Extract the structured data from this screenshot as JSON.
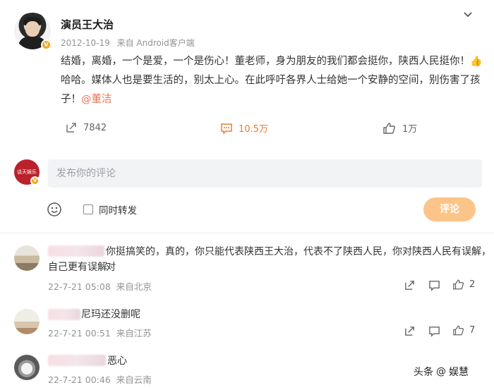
{
  "post": {
    "author": "演员王大治",
    "date": "2012-10-19",
    "source": "来自 Android客户端",
    "text_before": "结婚，离婚，一个是爱，一个是伤心！董老师，身为朋友的我们都会挺你，陕西人民挺你！",
    "text_after": "哈哈。媒体人也是要生活的，别太上心。在此呼吁各界人士给她一个安静的空间，别伤害了孩子！",
    "mention": "@董洁",
    "reposts": "7842",
    "comments": "10.5万",
    "likes": "1万"
  },
  "composer": {
    "avatar_text": "谈天娱乐",
    "placeholder": "发布你的评论",
    "repost_label": "同时转发",
    "submit_label": "评论"
  },
  "comments": [
    {
      "text_line1": "你挺搞笑的，真的，你只能代表陕西王大治，代表不了陕西人民，你对陕西人民有误解，对",
      "text_line2": "自己更有误解",
      "date": "22-7-21 05:08",
      "location": "来自北京",
      "likes": "2"
    },
    {
      "text_line1": "尼玛还没删呢",
      "date": "22-7-21 00:51",
      "location": "来自江苏",
      "likes": "7"
    },
    {
      "text_line1": "恶心",
      "date": "22-7-21 00:46",
      "location": "来自云南",
      "likes": ""
    }
  ],
  "watermark": {
    "left": "头条",
    "right": "娱慧"
  },
  "colors": {
    "accent": "#f07b2d",
    "mention": "#eb7350",
    "submit_disabled": "#fbc58a",
    "input_bg": "#f2f3f5"
  }
}
